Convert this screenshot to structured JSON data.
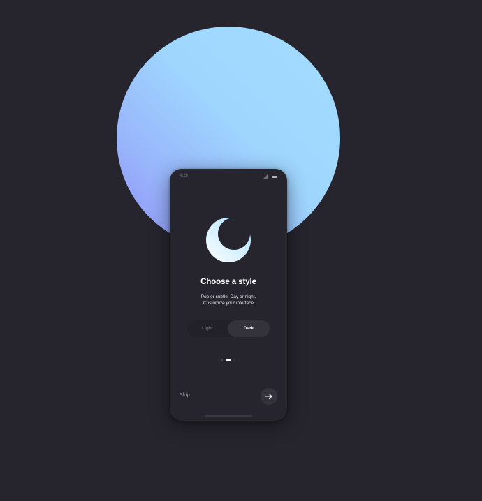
{
  "status_bar": {
    "time": "4:20",
    "signal_icon": "signal-icon",
    "battery_icon": "battery-icon"
  },
  "onboarding": {
    "hero_icon": "moon-icon",
    "title": "Choose a style",
    "subtitle_line1": "Pop or subtle. Day or night.",
    "subtitle_line2": "Customize your interface",
    "toggle": {
      "options": [
        "Light",
        "Dark"
      ],
      "selected": "Dark"
    },
    "pagination": {
      "total": 3,
      "current": 2
    },
    "skip_label": "Skip",
    "next_icon": "arrow-right-icon"
  },
  "colors": {
    "background": "#26252e",
    "accent_gradient_start": "#a3dcff",
    "accent_gradient_end": "#8f8df7",
    "text_primary": "#ffffff",
    "text_muted": "#7b7a83"
  }
}
